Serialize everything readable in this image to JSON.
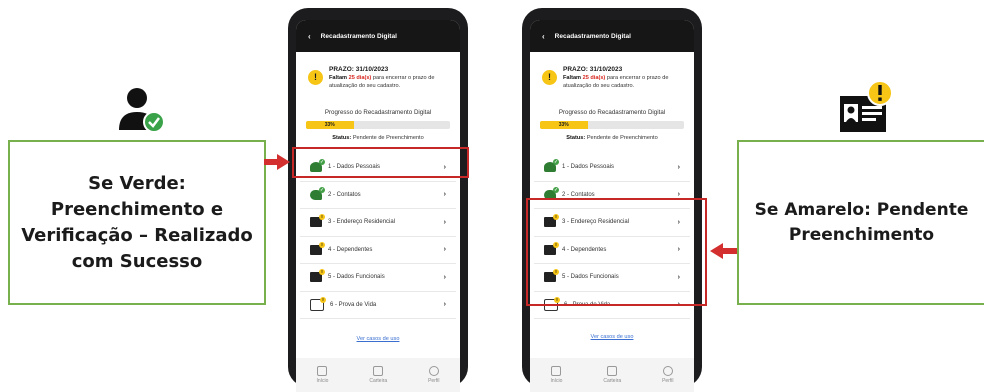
{
  "left_callout": {
    "lines": [
      "Se Verde:",
      "Preenchimento e",
      "Verificação – Realizado",
      "com Sucesso"
    ]
  },
  "right_callout": {
    "lines": [
      "Se Amarelo: Pendente",
      "Preenchimento"
    ]
  },
  "icons": {
    "left_big": "user-check-icon",
    "right_big": "id-card-alert-icon"
  },
  "colors": {
    "callout_border": "#79b04e",
    "highlight": "#c62828",
    "accent_yellow": "#f6c515",
    "accent_green": "#2e7d32",
    "deadline_red": "#d7261f"
  },
  "phone": {
    "app_title": "Recadastramento Digital",
    "deadline_title": "PRAZO: 31/10/2023",
    "deadline_prefix": "Faltam",
    "deadline_days": "25 dia(s)",
    "deadline_rest": "para encerrar o prazo de",
    "deadline_line2": "atualização do seu cadastro.",
    "progress_title": "Progresso do Recadastramento Digital",
    "progress_value": 0.33,
    "progress_label": "33%",
    "status_label": "Status:",
    "status_value": "Pendente de Preenchimento",
    "menu": [
      {
        "label": "1 - Dados Pessoais",
        "icon": "person-check-icon",
        "state": "green"
      },
      {
        "label": "2 - Contatos",
        "icon": "contacts-check-icon",
        "state": "green"
      },
      {
        "label": "3 - Endereço Residencial",
        "icon": "address-alert-icon",
        "state": "yellow"
      },
      {
        "label": "4 - Dependentes",
        "icon": "dependents-alert-icon",
        "state": "yellow"
      },
      {
        "label": "5 - Dados Funcionais",
        "icon": "functional-alert-icon",
        "state": "yellow"
      },
      {
        "label": "6 - Prova de Vida",
        "icon": "face-scan-alert-icon",
        "state": "yellow"
      }
    ],
    "link_phone1": "Ver casos de uso",
    "link_phone2": "Ver casos de uso",
    "nav": [
      "Início",
      "Carteira",
      "Perfil"
    ]
  }
}
